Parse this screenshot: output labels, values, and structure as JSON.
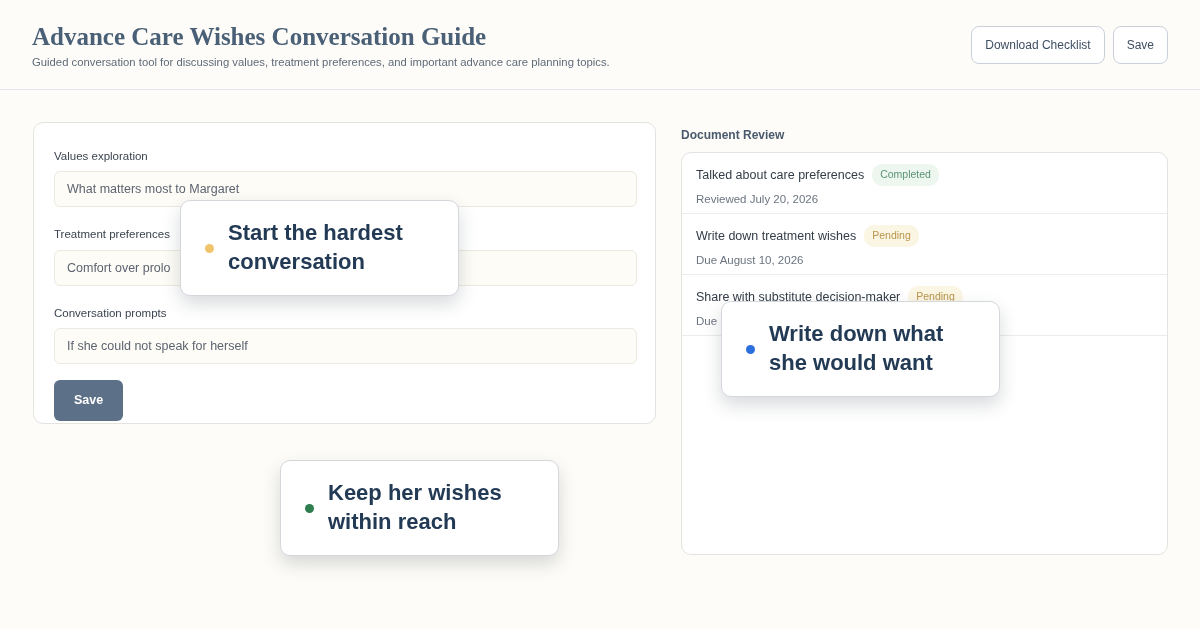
{
  "header": {
    "title": "Advance Care Wishes Conversation Guide",
    "subtitle": "Guided conversation tool for discussing values, treatment preferences, and important advance care planning topics.",
    "buttons": [
      "Download Checklist",
      "Save"
    ]
  },
  "form": {
    "fields": [
      {
        "label": "Values exploration",
        "value": "What matters most to Margaret"
      },
      {
        "label": "Treatment preferences",
        "value": "Comfort over prolo"
      },
      {
        "label": "Conversation prompts",
        "value": "If she could not speak for herself"
      }
    ],
    "button": "Save"
  },
  "review": {
    "title": "Document Review",
    "items": [
      {
        "title": "Talked about care preferences",
        "status": "Completed",
        "kind": "completed",
        "date": "Reviewed July 20, 2026"
      },
      {
        "title": "Write down treatment wishes",
        "status": "Pending",
        "kind": "pending",
        "date": "Due August 10, 2026"
      },
      {
        "title": "Share with substitute decision-maker",
        "status": "Pending",
        "kind": "pending",
        "date": "Due"
      }
    ]
  },
  "callouts": [
    {
      "text": "Start the hardest conversation",
      "color": "#f0c46c"
    },
    {
      "text": "Write down what she would want",
      "color": "#2a6fdb"
    },
    {
      "text": "Keep her wishes within reach",
      "color": "#2e7d4f"
    }
  ]
}
